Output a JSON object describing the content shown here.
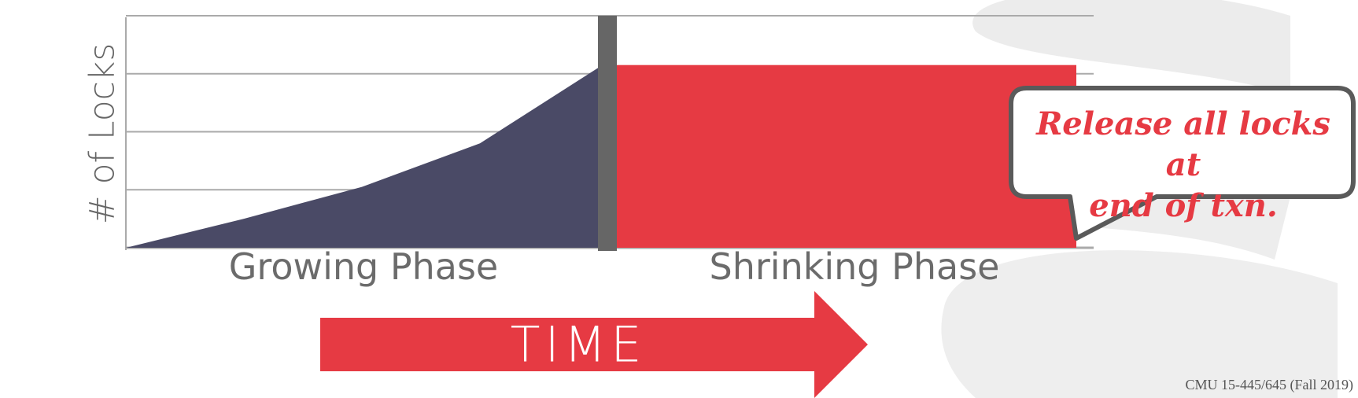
{
  "chart_data": {
    "type": "area",
    "ylabel": "# of Locks",
    "phases": [
      "Growing Phase",
      "Shrinking Phase"
    ],
    "growing_series": {
      "x": [
        0,
        1,
        2,
        3,
        4
      ],
      "y": [
        0,
        1,
        2.1,
        3.6,
        6.2
      ]
    },
    "shrinking_level": 6.3,
    "ylim": [
      0,
      8
    ],
    "gridlines": [
      2,
      4,
      6,
      8
    ],
    "grid": true,
    "colors": {
      "growing": "#4a4a66",
      "shrinking": "#e63a43",
      "divider": "#666666",
      "grid": "#aaaaaa"
    }
  },
  "time_arrow": {
    "label": "TIME",
    "color": "#e63a43"
  },
  "callout": {
    "line1": "Release all locks at",
    "line2": "end of txn."
  },
  "footer": "CMU 15-445/645 (Fall 2019)"
}
